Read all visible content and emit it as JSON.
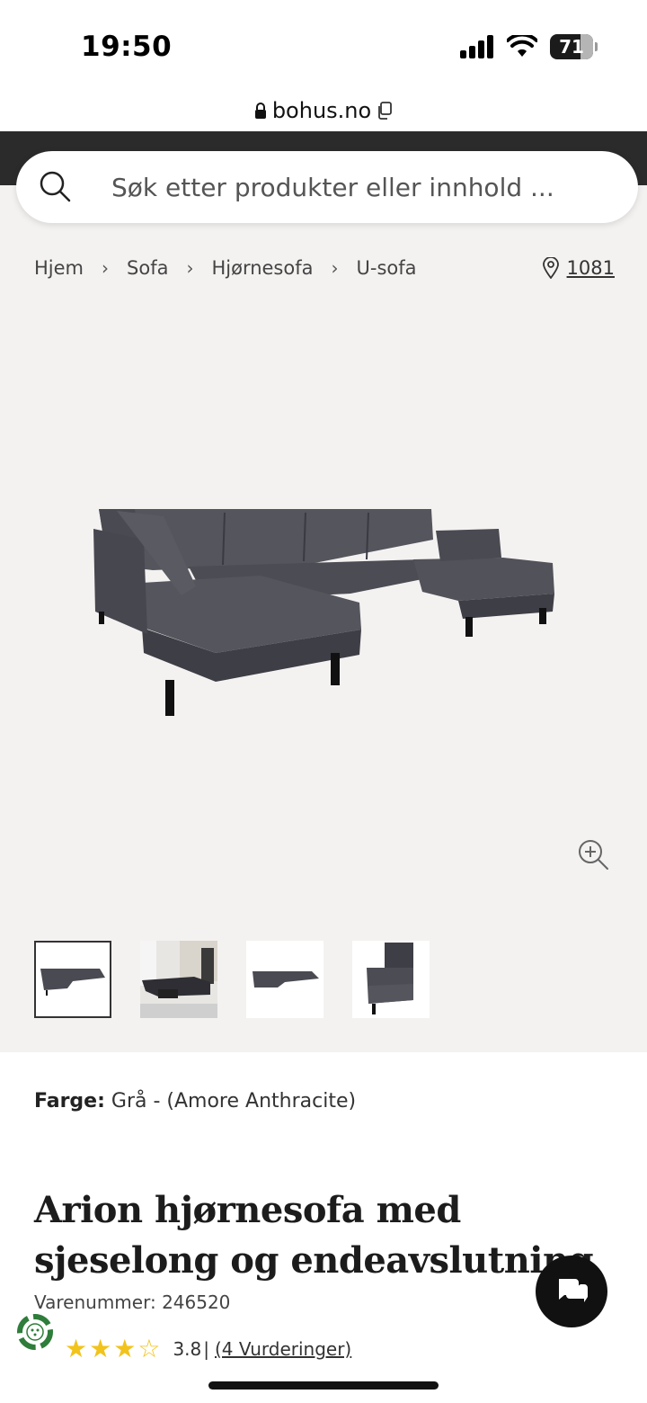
{
  "status": {
    "time": "19:50",
    "battery": "71"
  },
  "browser": {
    "url": "bohus.no"
  },
  "search": {
    "placeholder": "Søk etter produkter eller innhold ..."
  },
  "breadcrumb": {
    "items": [
      "Hjem",
      "Sofa",
      "Hjørnesofa",
      "U-sofa"
    ],
    "store": "1081"
  },
  "product": {
    "color_label": "Farge:",
    "color_value": "Grå - (Amore Anthracite)",
    "title": "Arion hjørnesofa med sjeselong og endeavslutning",
    "sku_label": "Varenummer:",
    "sku_value": "246520",
    "rating": 3.8,
    "rating_text": "3.8",
    "reviews_text": "(4 Vurderinger)"
  },
  "icons": {
    "search": "search-icon",
    "zoom": "zoom-in-icon",
    "location": "location-pin-icon",
    "chat": "chat-icon",
    "recycle": "recycle-icon",
    "lock": "lock-icon",
    "copy": "copy-icon"
  },
  "colors": {
    "header": "#2b2b2b",
    "page_bg": "#f4f2f1",
    "star": "#f2c31b",
    "sofa": "#4a4a52"
  }
}
